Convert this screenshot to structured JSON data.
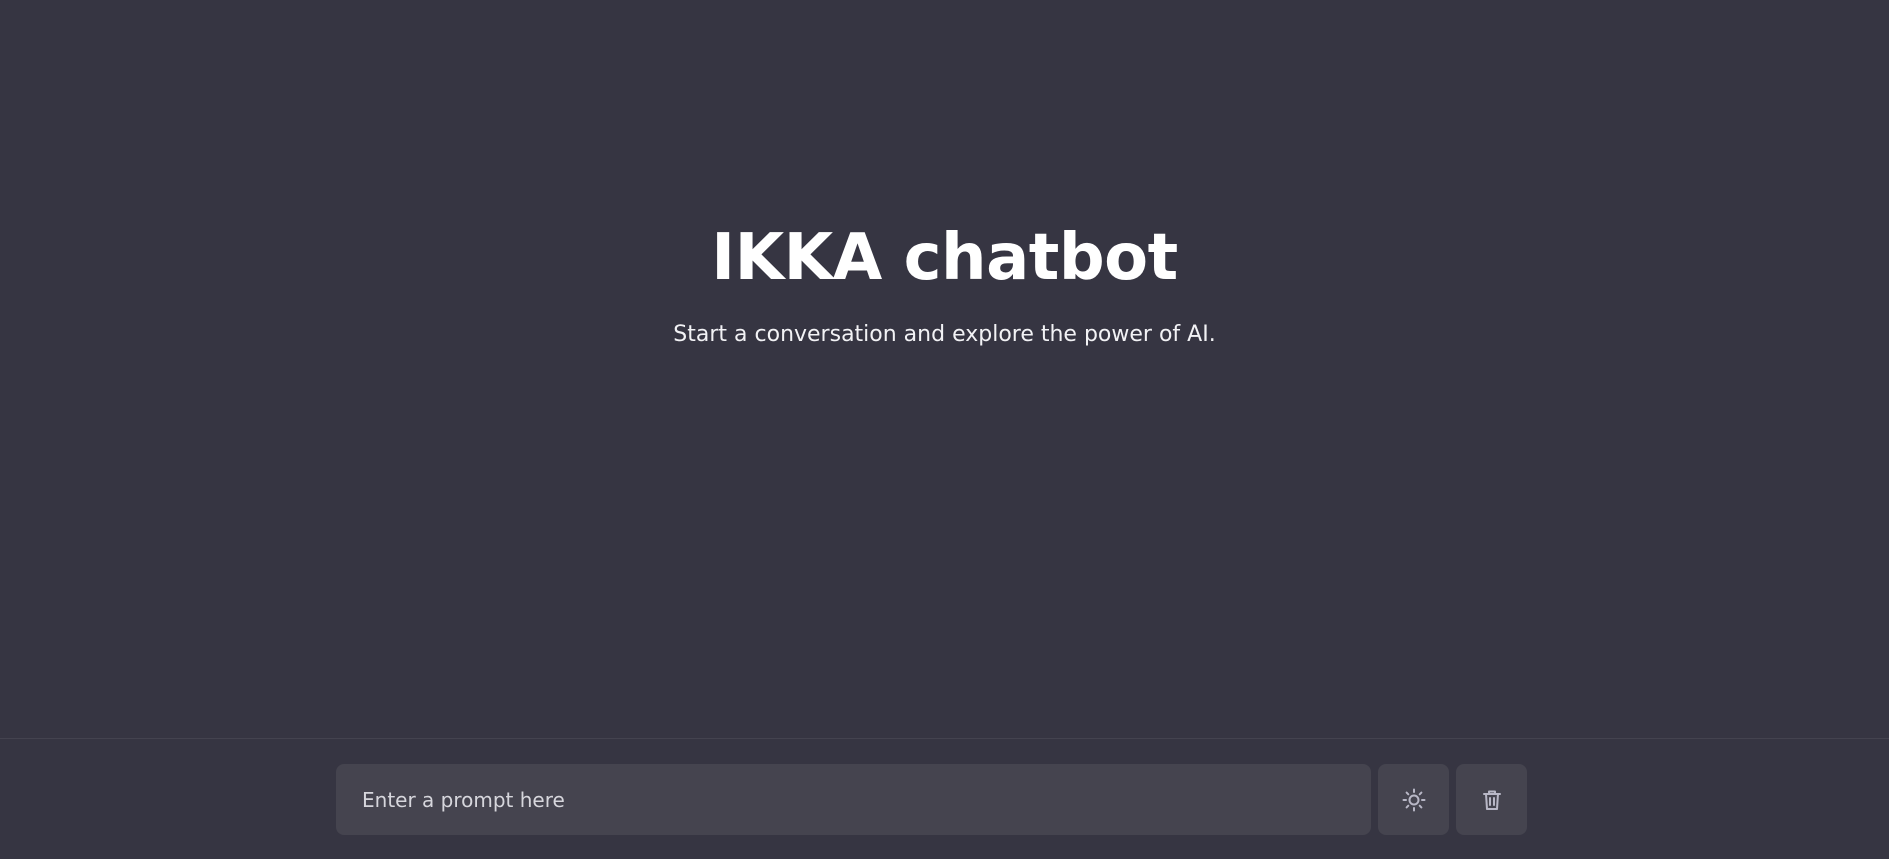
{
  "header": {
    "title": "IKKA chatbot",
    "subtitle": "Start a conversation and explore the power of AI."
  },
  "prompt": {
    "placeholder": "Enter a prompt here",
    "value": ""
  },
  "buttons": {
    "theme_toggle_icon": "sun-icon",
    "clear_chat_icon": "trash-icon"
  },
  "colors": {
    "background": "#363542",
    "input_background": "#45444f",
    "text": "#ffffff",
    "icon": "#b8b7c6"
  }
}
